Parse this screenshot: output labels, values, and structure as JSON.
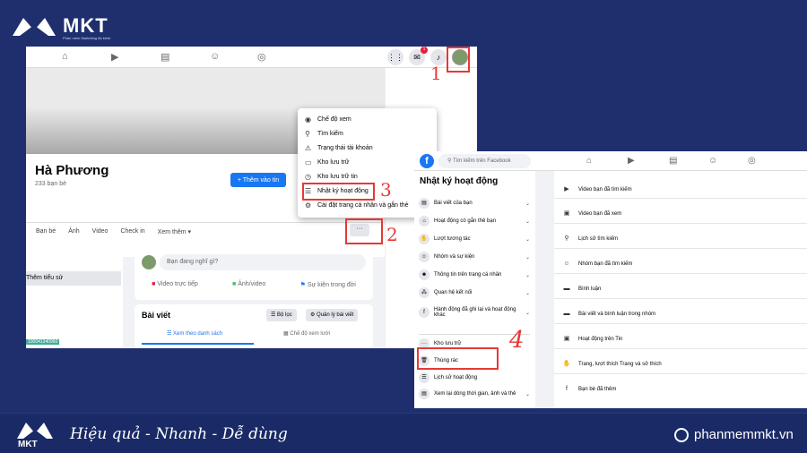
{
  "brand": {
    "name": "MKT",
    "tagline": "Phần mềm Marketing đa kênh"
  },
  "profile": {
    "name": "Hà Phương",
    "friends": "233 bạn bè",
    "add_story": "+ Thêm vào tin",
    "tabs": [
      "Bạn bè",
      "Ảnh",
      "Video",
      "Check in",
      "Xem thêm ▾"
    ],
    "more_button": "···",
    "intro_item": "Thêm tiểu sử",
    "id_tag": "100041340960",
    "composer_placeholder": "Bạn đang nghĩ gì?",
    "composer_actions": [
      "Video trực tiếp",
      "Ảnh/video",
      "Sự kiện trong đời"
    ],
    "posts_title": "Bài viết",
    "filter_button": "Bộ lọc",
    "manage_button": "Quản lý bài viết",
    "view_list": "Xem theo danh sách",
    "view_grid": "Chế độ xem lưới"
  },
  "menu": {
    "items": [
      "Chế độ xem",
      "Tìm kiếm",
      "Trạng thái tài khoản",
      "Kho lưu trữ",
      "Kho lưu trữ tin",
      "Nhật ký hoạt động",
      "Cài đặt trang cá nhân và gắn thẻ"
    ],
    "icons": [
      "eye-icon",
      "search-icon",
      "alert-icon",
      "archive-icon",
      "clock-icon",
      "list-icon",
      "settings-icon"
    ]
  },
  "steps": [
    "1",
    "2",
    "3",
    "4"
  ],
  "activity": {
    "search_placeholder": "Tìm kiếm trên Facebook",
    "title": "Nhật ký hoạt động",
    "sidebar": [
      "Bài viết của bạn",
      "Hoạt động có gắn thẻ bạn",
      "Lượt tương tác",
      "Nhóm và sự kiện",
      "Thông tin trên trang cá nhân",
      "Quan hệ kết nối",
      "Hành động đã ghi lại và hoạt động khác",
      "Kho lưu trữ",
      "Thùng rác",
      "Lịch sử hoạt động",
      "Xem lại dòng thời gian, ảnh và thẻ"
    ],
    "main": [
      "Video bạn đã tìm kiếm",
      "Video bạn đã xem",
      "Lịch sử tìm kiếm",
      "Nhóm bạn đã tìm kiếm",
      "Bình luận",
      "Bài viết và bình luận trong nhóm",
      "Hoạt động trên Tin",
      "Trang, lượt thích Trang và sở thích",
      "Bạn bè đã thêm"
    ]
  },
  "footer": {
    "logo": "MKT",
    "slogan": "Hiệu quả - Nhanh  - Dễ dùng",
    "site": "phanmemmkt.vn"
  },
  "colors": {
    "background": "#1f2f6e",
    "facebook_blue": "#1877f2",
    "highlight_red": "#e53935"
  }
}
